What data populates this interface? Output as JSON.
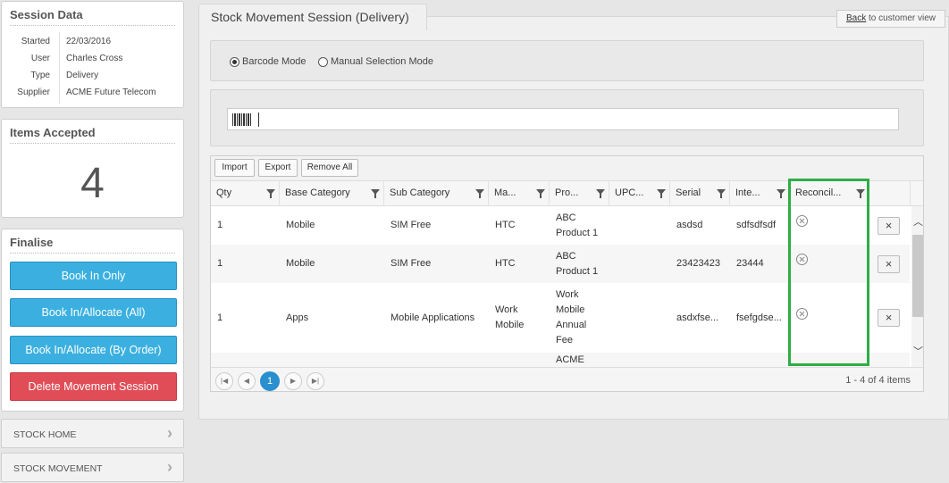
{
  "session": {
    "title": "Session Data",
    "fields": [
      {
        "key": "Started",
        "value": "22/03/2016"
      },
      {
        "key": "User",
        "value": "Charles Cross"
      },
      {
        "key": "Type",
        "value": "Delivery"
      },
      {
        "key": "Supplier",
        "value": "ACME Future Telecom"
      }
    ]
  },
  "accepted": {
    "title": "Items Accepted",
    "count": "4"
  },
  "finalise": {
    "title": "Finalise",
    "buttons": [
      "Book In Only",
      "Book In/Allocate (All)",
      "Book In/Allocate (By Order)",
      "Delete Movement Session"
    ]
  },
  "nav": [
    "STOCK HOME",
    "STOCK MOVEMENT"
  ],
  "main": {
    "tab_title": "Stock Movement Session (Delivery)",
    "back_link": "Back",
    "back_suffix": " to customer view",
    "modes": [
      "Barcode Mode",
      "Manual Selection Mode"
    ],
    "selected_mode": "Barcode Mode"
  },
  "grid": {
    "toolbar": [
      "Import",
      "Export",
      "Remove All"
    ],
    "columns": [
      "Qty",
      "Base Category",
      "Sub Category",
      "Ma...",
      "Pro...",
      "UPC...",
      "Serial",
      "Inte...",
      "Reconcil..."
    ],
    "rows": [
      {
        "qty": "1",
        "base": "Mobile",
        "sub": "SIM Free",
        "make": "HTC",
        "product": "ABC Product 1",
        "upc": "",
        "serial": "asdsd",
        "internal": "sdfsdfsdf"
      },
      {
        "qty": "1",
        "base": "Mobile",
        "sub": "SIM Free",
        "make": "HTC",
        "product": "ABC Product 1",
        "upc": "",
        "serial": "23423423",
        "internal": "23444"
      },
      {
        "qty": "1",
        "base": "Apps",
        "sub": "Mobile Applications",
        "make": "Work Mobile",
        "product": "Work Mobile Annual Fee",
        "upc": "",
        "serial": "asdxfse...",
        "internal": "fsefgdse..."
      },
      {
        "qty": "",
        "base": "",
        "sub": "",
        "make": "",
        "product": "ACME",
        "upc": "",
        "serial": "",
        "internal": ""
      }
    ],
    "pager": {
      "current": "1",
      "info": "1 - 4 of 4 items"
    },
    "delete_glyph": "×"
  }
}
